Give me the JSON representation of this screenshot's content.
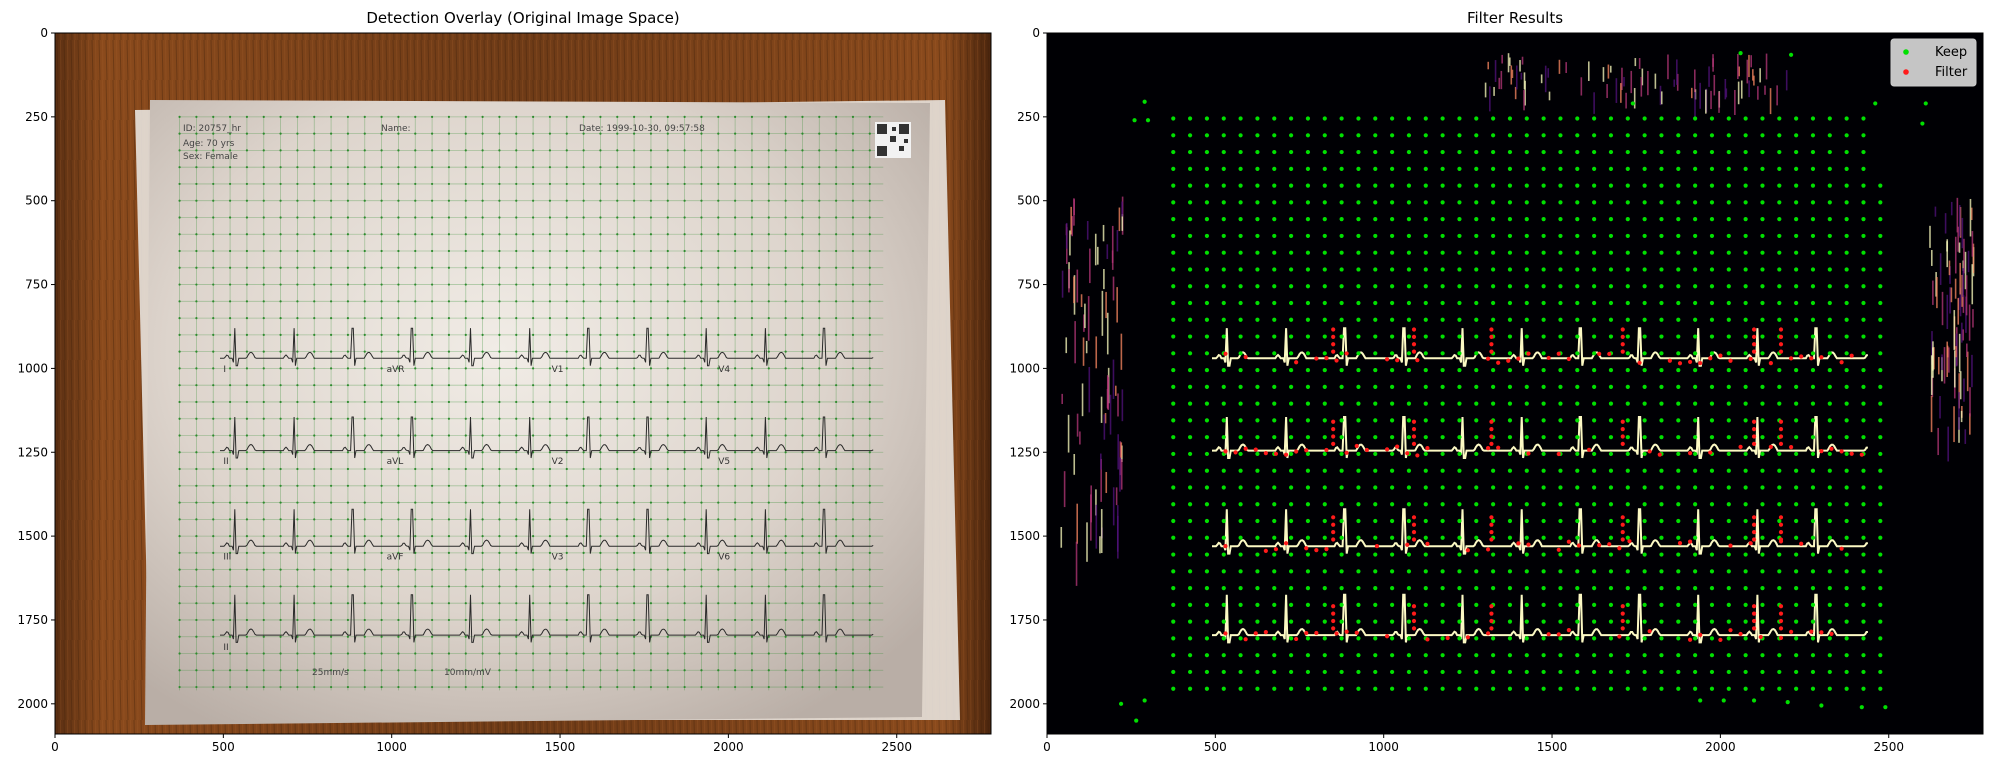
{
  "figure": {
    "left_title": "Detection Overlay (Original Image Space)",
    "right_title": "Filter Results"
  },
  "chart_data": [
    {
      "type": "scatter",
      "title": "Detection Overlay (Original Image Space)",
      "xlim": [
        0,
        2780
      ],
      "ylim": [
        2090,
        0
      ],
      "xticks": [
        0,
        500,
        1000,
        1500,
        2000,
        2500
      ],
      "yticks": [
        0,
        250,
        500,
        750,
        1000,
        1250,
        1500,
        1750,
        2000
      ],
      "background_image": "photo of printed 12-lead ECG sheet on wooden table with detected grid points overlaid",
      "ecg_sheet_text": {
        "id": "ID: 20757_hr",
        "age": "Age: 70 yrs",
        "sex": "Sex: Female",
        "name": "Name:",
        "date": "Date: 1999-10-30, 09:57:58",
        "speed": "25mm/s",
        "gain": "10mm/mV",
        "leads": [
          "I",
          "aVR",
          "V1",
          "V4",
          "II",
          "aVL",
          "V2",
          "V5",
          "III",
          "aVF",
          "V3",
          "V6",
          "II"
        ]
      },
      "grid_points": {
        "x_range": [
          370,
          2460
        ],
        "y_range": [
          250,
          1960
        ],
        "spacing": 50,
        "color": "#2e8b2e"
      }
    },
    {
      "type": "scatter",
      "title": "Filter Results",
      "xlim": [
        0,
        2780
      ],
      "ylim": [
        2090,
        0
      ],
      "xticks": [
        0,
        500,
        1000,
        1500,
        2000,
        2500
      ],
      "yticks": [
        0,
        250,
        500,
        750,
        1000,
        1250,
        1500,
        1750,
        2000
      ],
      "background_image": "dark magma-colormap heat map of detected ECG traces",
      "legend": {
        "position": "top-right",
        "entries": [
          {
            "label": "Keep",
            "color": "#00e000"
          },
          {
            "label": "Filter",
            "color": "#ff1a1a"
          }
        ]
      },
      "series": [
        {
          "name": "Keep",
          "color": "#00e000",
          "grid": {
            "x_range": [
              375,
              2430
            ],
            "y_range": [
              255,
              1970
            ],
            "spacing": 50
          }
        },
        {
          "name": "Filter",
          "color": "#ff1a1a",
          "approx_points_along_traces": true
        }
      ],
      "trace_baselines_y": [
        970,
        1245,
        1530,
        1795
      ]
    }
  ]
}
